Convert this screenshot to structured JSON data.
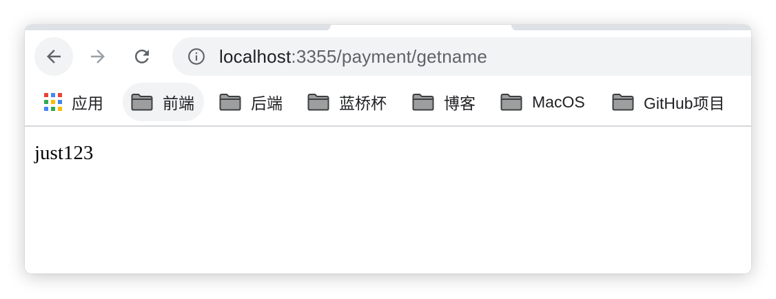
{
  "toolbar": {
    "back_icon": "arrow-left-icon",
    "forward_icon": "arrow-right-icon",
    "reload_icon": "reload-icon"
  },
  "omnibox": {
    "info_icon": "info-circle-icon",
    "host": "localhost",
    "path": ":3355/payment/getname"
  },
  "bookmarks": {
    "apps_label": "应用",
    "items": [
      {
        "label": "前端",
        "icon": "folder-icon"
      },
      {
        "label": "后端",
        "icon": "folder-icon"
      },
      {
        "label": "蓝桥杯",
        "icon": "folder-icon"
      },
      {
        "label": "博客",
        "icon": "folder-icon"
      },
      {
        "label": "MacOS",
        "icon": "folder-icon"
      },
      {
        "label": "GitHub项目",
        "icon": "folder-icon"
      }
    ]
  },
  "page": {
    "body_text": "just123"
  },
  "colors": {
    "toolbar_bg": "#ffffff",
    "omnibox_bg": "#f1f3f4",
    "icon_gray": "#5f6368",
    "disabled_gray": "#9aa0a6",
    "apps_red": "#ea4335",
    "apps_blue": "#4285f4",
    "apps_green": "#34a853",
    "apps_yellow": "#fbbc05"
  }
}
